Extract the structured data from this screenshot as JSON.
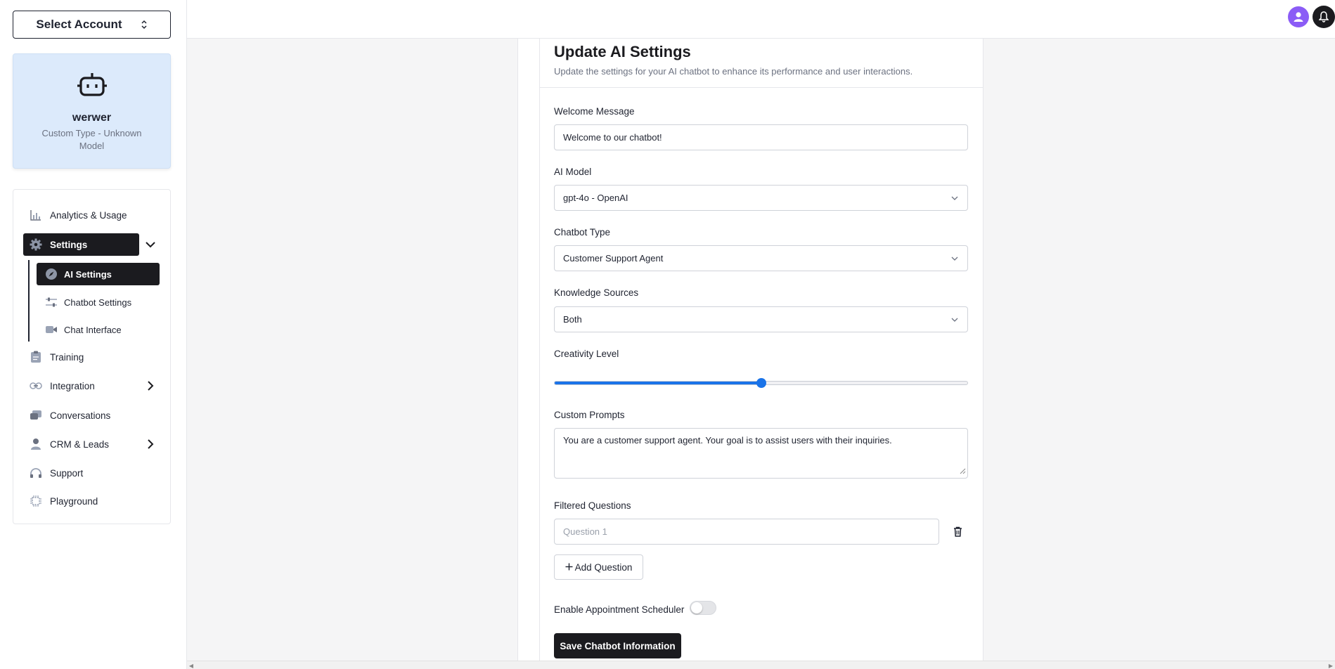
{
  "account_select": {
    "label": "Select Account"
  },
  "bot": {
    "name": "werwer",
    "subtitle": "Custom Type - Unknown Model"
  },
  "nav": {
    "analytics": "Analytics & Usage",
    "settings": "Settings",
    "sub": {
      "ai_settings": "AI Settings",
      "chatbot_settings": "Chatbot Settings",
      "chat_interface": "Chat Interface"
    },
    "training": "Training",
    "integration": "Integration",
    "conversations": "Conversations",
    "crm": "CRM & Leads",
    "support": "Support",
    "playground": "Playground"
  },
  "form": {
    "title": "Update AI Settings",
    "description": "Update the settings for your AI chatbot to enhance its performance and user interactions.",
    "welcome_label": "Welcome Message",
    "welcome_value": "Welcome to our chatbot!",
    "model_label": "AI Model",
    "model_value": "gpt-4o - OpenAI",
    "type_label": "Chatbot Type",
    "type_value": "Customer Support Agent",
    "sources_label": "Knowledge Sources",
    "sources_value": "Both",
    "creativity_label": "Creativity Level",
    "creativity_value": 0.5,
    "prompts_label": "Custom Prompts",
    "prompts_value": "You are a customer support agent. Your goal is to assist users with their inquiries.",
    "filtered_label": "Filtered Questions",
    "question_placeholder": "Question 1",
    "add_question": "Add Question",
    "scheduler_label": "Enable Appointment Scheduler",
    "scheduler_enabled": false,
    "save_label": "Save Chatbot Information"
  },
  "colors": {
    "accent": "#1a73e8",
    "dark": "#1b1b1f",
    "avatar": "#8b5cf6",
    "card_bg": "#dceafb"
  }
}
